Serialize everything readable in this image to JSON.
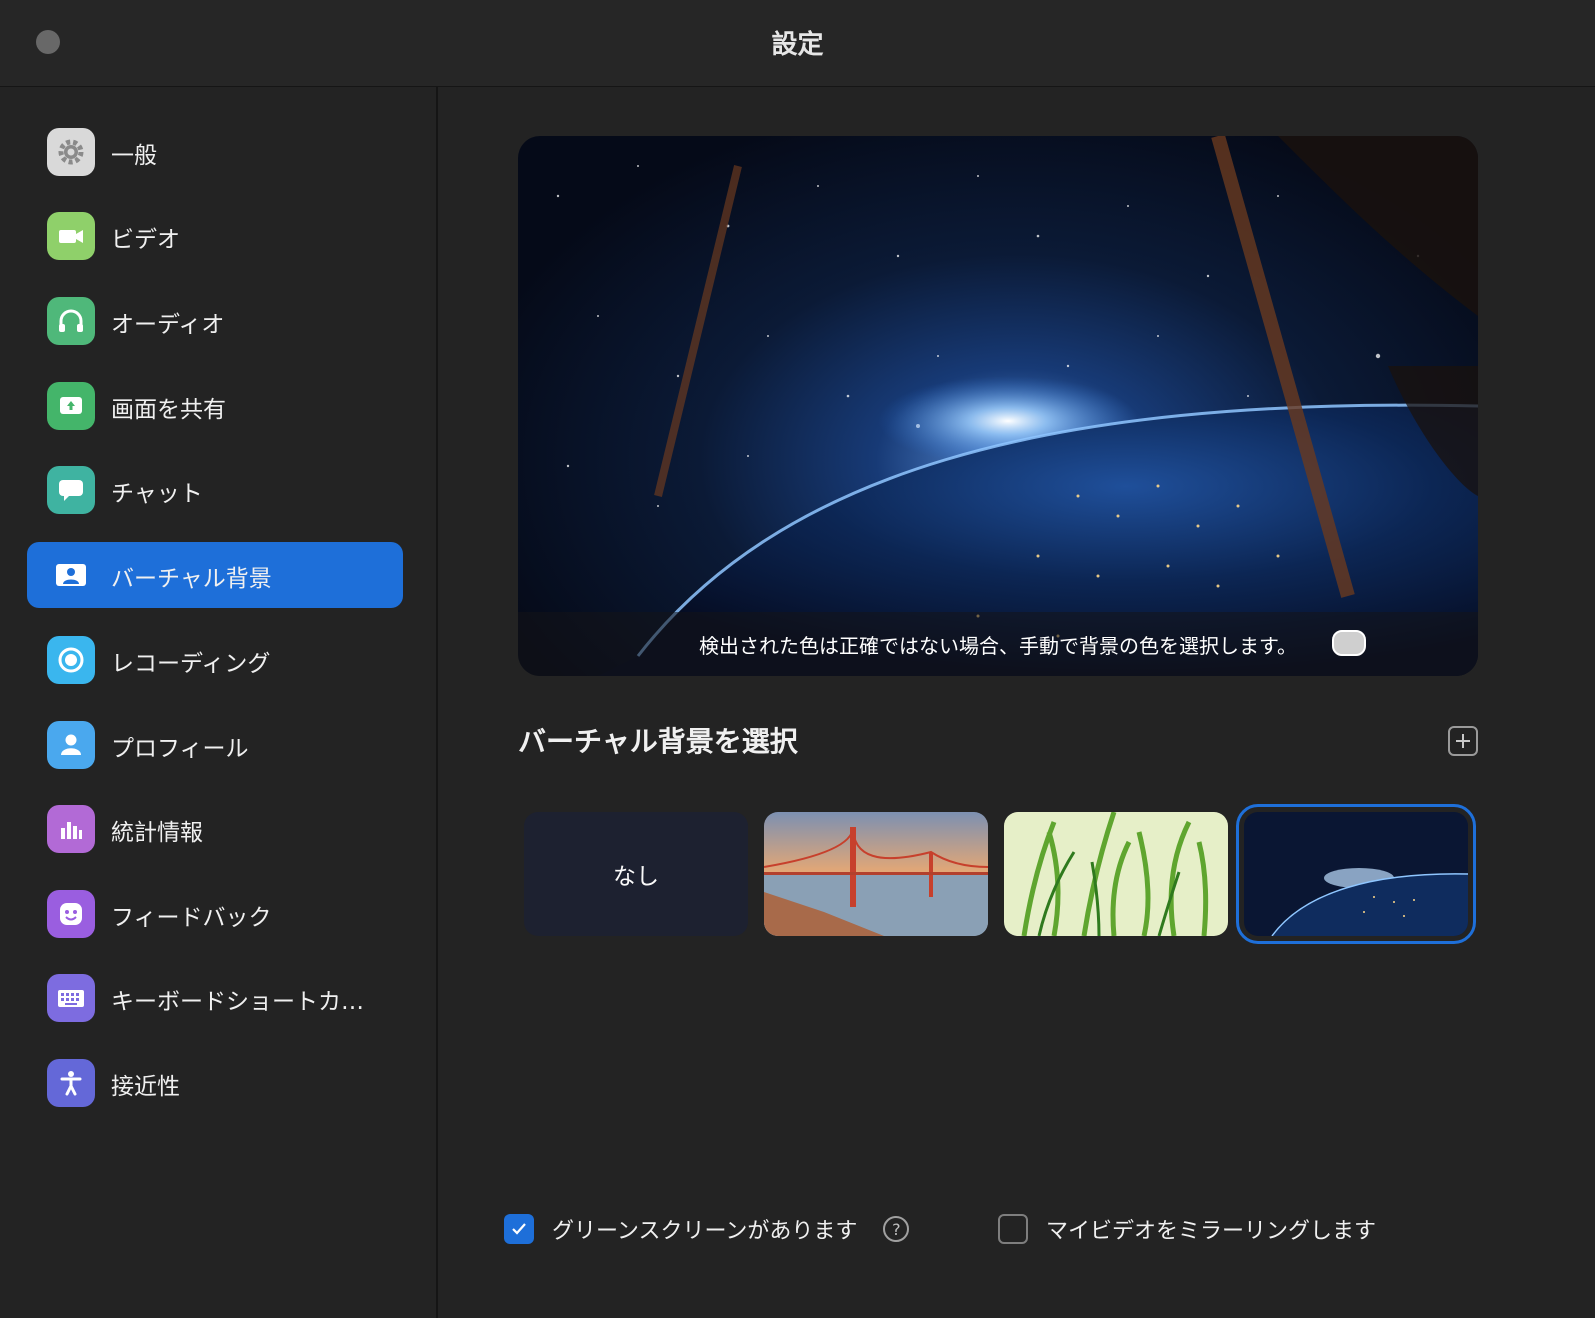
{
  "window": {
    "title": "設定"
  },
  "sidebar": {
    "items": [
      {
        "label": "一般",
        "icon": "gear-icon",
        "color": "#d9d9d9",
        "active": false
      },
      {
        "label": "ビデオ",
        "icon": "video-camera-icon",
        "color": "#8fd06a",
        "active": false
      },
      {
        "label": "オーディオ",
        "icon": "headphones-icon",
        "color": "#4fb87a",
        "active": false
      },
      {
        "label": "画面を共有",
        "icon": "share-screen-icon",
        "color": "#44b56a",
        "active": false
      },
      {
        "label": "チャット",
        "icon": "chat-bubble-icon",
        "color": "#3fb3a1",
        "active": false
      },
      {
        "label": "バーチャル背景",
        "icon": "virtual-background-icon",
        "color": "#1e6fd9",
        "active": true
      },
      {
        "label": "レコーディング",
        "icon": "record-icon",
        "color": "#3ab6ee",
        "active": false
      },
      {
        "label": "プロフィール",
        "icon": "person-icon",
        "color": "#4aa8ee",
        "active": false
      },
      {
        "label": "統計情報",
        "icon": "bar-chart-icon",
        "color": "#b26ad6",
        "active": false
      },
      {
        "label": "フィードバック",
        "icon": "smiley-icon",
        "color": "#9a5ee0",
        "active": false
      },
      {
        "label": "キーボードショートカ…",
        "icon": "keyboard-icon",
        "color": "#7d6ce0",
        "active": false
      },
      {
        "label": "接近性",
        "icon": "accessibility-icon",
        "color": "#6468d8",
        "active": false
      }
    ]
  },
  "preview": {
    "caption": "検出された色は正確ではない場合、手動で背景の色を選択します。"
  },
  "section": {
    "title": "バーチャル背景を選択"
  },
  "thumbnails": {
    "none_label": "なし",
    "items": [
      "none",
      "golden-gate-bridge",
      "grass",
      "earth-space"
    ],
    "selected": "earth-space"
  },
  "options": {
    "green_screen": {
      "label": "グリーンスクリーンがあります",
      "checked": true
    },
    "mirror": {
      "label": "マイビデオをミラーリングします",
      "checked": false
    },
    "help_glyph": "?"
  },
  "colors": {
    "accent": "#1e6fd9",
    "background": "#232323"
  }
}
